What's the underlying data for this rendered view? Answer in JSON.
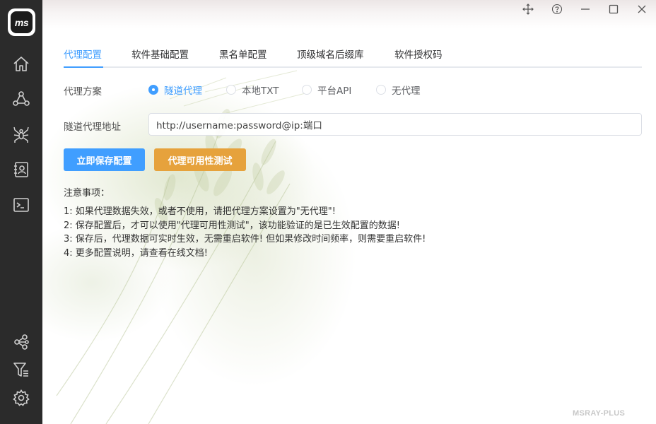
{
  "sidebar": {
    "logo_text": "ms",
    "nav_top": [
      "home-icon",
      "network-icon",
      "spider-icon",
      "contacts-icon",
      "terminal-icon"
    ],
    "nav_bottom": [
      "share-icon",
      "filter-list-icon",
      "settings-icon"
    ]
  },
  "window_controls": [
    "move-icon",
    "help-icon",
    "minimize-icon",
    "maximize-icon",
    "close-icon"
  ],
  "tabs": [
    {
      "label": "代理配置",
      "active": true
    },
    {
      "label": "软件基础配置",
      "active": false
    },
    {
      "label": "黑名单配置",
      "active": false
    },
    {
      "label": "顶级域名后缀库",
      "active": false
    },
    {
      "label": "软件授权码",
      "active": false
    }
  ],
  "form": {
    "proxy_mode_label": "代理方案",
    "proxy_options": [
      {
        "label": "隧道代理",
        "checked": true
      },
      {
        "label": "本地TXT",
        "checked": false
      },
      {
        "label": "平台API",
        "checked": false
      },
      {
        "label": "无代理",
        "checked": false
      }
    ],
    "tunnel_address_label": "隧道代理地址",
    "tunnel_address_value": "http://username:password@ip:端口"
  },
  "buttons": {
    "save_label": "立即保存配置",
    "test_label": "代理可用性测试"
  },
  "notes": {
    "title": "注意事项：",
    "items": [
      "1: 如果代理数据失效，或者不使用，请把代理方案设置为\"无代理\"!",
      "2: 保存配置后，才可以使用\"代理可用性测试\"，该功能验证的是已生效配置的数据!",
      "3: 保存后，代理数据可实时生效，无需重启软件! 但如果修改时间频率，则需要重启软件!",
      "4: 更多配置说明，请查看在线文档!"
    ]
  },
  "brand": "MSRAY-PLUS",
  "colors": {
    "accent": "#409eff",
    "warning": "#e6a23c",
    "sidebar": "#2b2b2b"
  }
}
